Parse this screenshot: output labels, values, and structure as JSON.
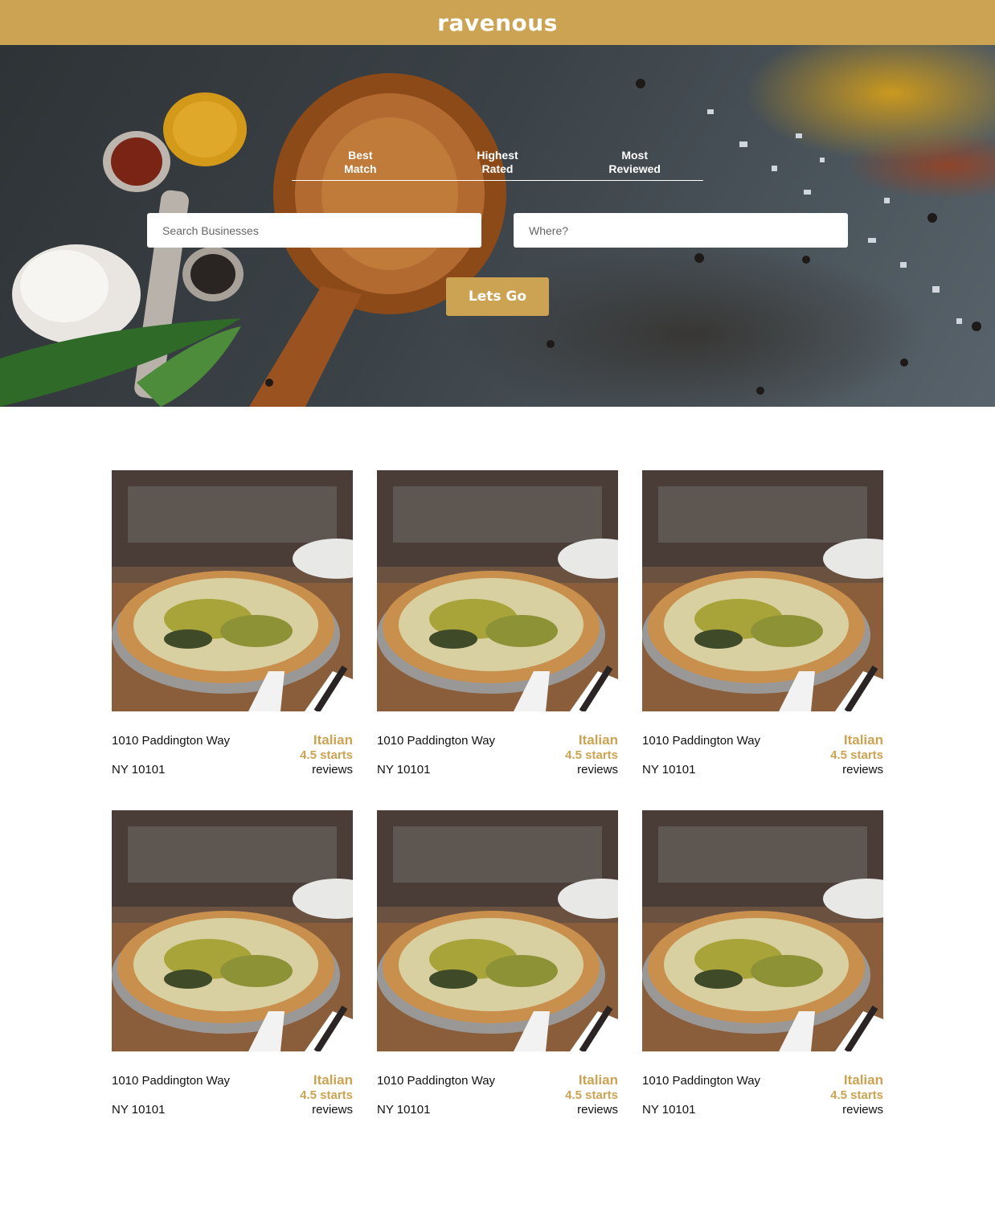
{
  "app": {
    "title": "ravenous"
  },
  "colors": {
    "accent": "#cca353",
    "text": "#111111"
  },
  "sort_options": [
    {
      "label_line1": "Best",
      "label_line2": "Match"
    },
    {
      "label_line1": "Highest",
      "label_line2": "Rated"
    },
    {
      "label_line1": "Most",
      "label_line2": "Reviewed"
    }
  ],
  "search": {
    "business_placeholder": "Search Businesses",
    "location_placeholder": "Where?",
    "button_label": "Lets Go"
  },
  "businesses": [
    {
      "address": "1010 Paddington Way",
      "city_zip": "NY 10101",
      "category": "Italian",
      "rating": "4.5 starts",
      "reviews": "reviews",
      "image": "pizza-photo"
    },
    {
      "address": "1010 Paddington Way",
      "city_zip": "NY 10101",
      "category": "Italian",
      "rating": "4.5 starts",
      "reviews": "reviews",
      "image": "pizza-photo"
    },
    {
      "address": "1010 Paddington Way",
      "city_zip": "NY 10101",
      "category": "Italian",
      "rating": "4.5 starts",
      "reviews": "reviews",
      "image": "pizza-photo"
    },
    {
      "address": "1010 Paddington Way",
      "city_zip": "NY 10101",
      "category": "Italian",
      "rating": "4.5 starts",
      "reviews": "reviews",
      "image": "pizza-photo"
    },
    {
      "address": "1010 Paddington Way",
      "city_zip": "NY 10101",
      "category": "Italian",
      "rating": "4.5 starts",
      "reviews": "reviews",
      "image": "pizza-photo"
    },
    {
      "address": "1010 Paddington Way",
      "city_zip": "NY 10101",
      "category": "Italian",
      "rating": "4.5 starts",
      "reviews": "reviews",
      "image": "pizza-photo"
    }
  ]
}
